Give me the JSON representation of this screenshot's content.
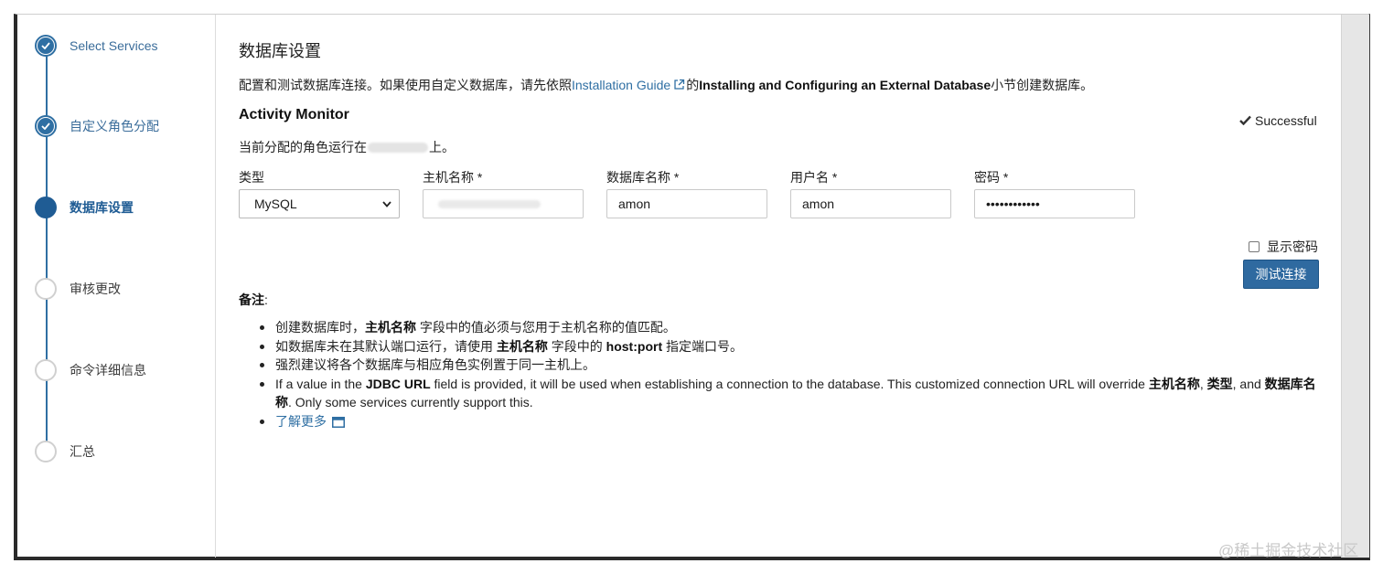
{
  "wizard": {
    "steps": [
      {
        "label": "Select Services",
        "state": "done"
      },
      {
        "label": "自定义角色分配",
        "state": "done"
      },
      {
        "label": "数据库设置",
        "state": "active"
      },
      {
        "label": "审核更改",
        "state": "pending"
      },
      {
        "label": "命令详细信息",
        "state": "pending"
      },
      {
        "label": "汇总",
        "state": "pending"
      }
    ]
  },
  "page": {
    "title": "数据库设置",
    "desc_prefix": "配置和测试数据库连接。如果使用自定义数据库，请先依照",
    "desc_link": "Installation Guide",
    "desc_middle": "的",
    "desc_bold": "Installing and Configuring an External Database",
    "desc_suffix": "小节创建数据库。"
  },
  "service": {
    "name": "Activity Monitor",
    "status": "Successful",
    "host_prefix": "当前分配的角色运行在",
    "host_suffix": "上。"
  },
  "form": {
    "type_label": "类型",
    "type_value": "MySQL",
    "host_label": "主机名称 *",
    "dbname_label": "数据库名称 *",
    "dbname_value": "amon",
    "user_label": "用户名 *",
    "user_value": "amon",
    "password_label": "密码 *",
    "password_value": "••••••••••••",
    "show_password": "显示密码",
    "test_button": "测试连接"
  },
  "notes": {
    "title": "备注",
    "colon": ":",
    "n1_a": "创建数据库时，",
    "n1_b": "主机名称",
    "n1_c": " 字段中的值必须与您用于主机名称的值匹配。",
    "n2_a": "如数据库未在其默认端口运行，请使用 ",
    "n2_b": "主机名称",
    "n2_c": " 字段中的 ",
    "n2_d": "host:port",
    "n2_e": " 指定端口号。",
    "n3": "强烈建议将各个数据库与相应角色实例置于同一主机上。",
    "n4_a": "If a value in the ",
    "n4_b": "JDBC URL",
    "n4_c": " field is provided, it will be used when establishing a connection to the database. This customized connection URL will override ",
    "n4_d": "主机名称",
    "n4_e": ", ",
    "n4_f": "类型",
    "n4_g": ", and ",
    "n4_h": "数据库名称",
    "n4_i": ". Only some services currently support this.",
    "learn_more": "了解更多"
  },
  "watermark": "@稀土掘金技术社区",
  "colors": {
    "accent": "#2f6fa3",
    "button": "#2f6aa0",
    "active_step": "#1f5c94"
  }
}
